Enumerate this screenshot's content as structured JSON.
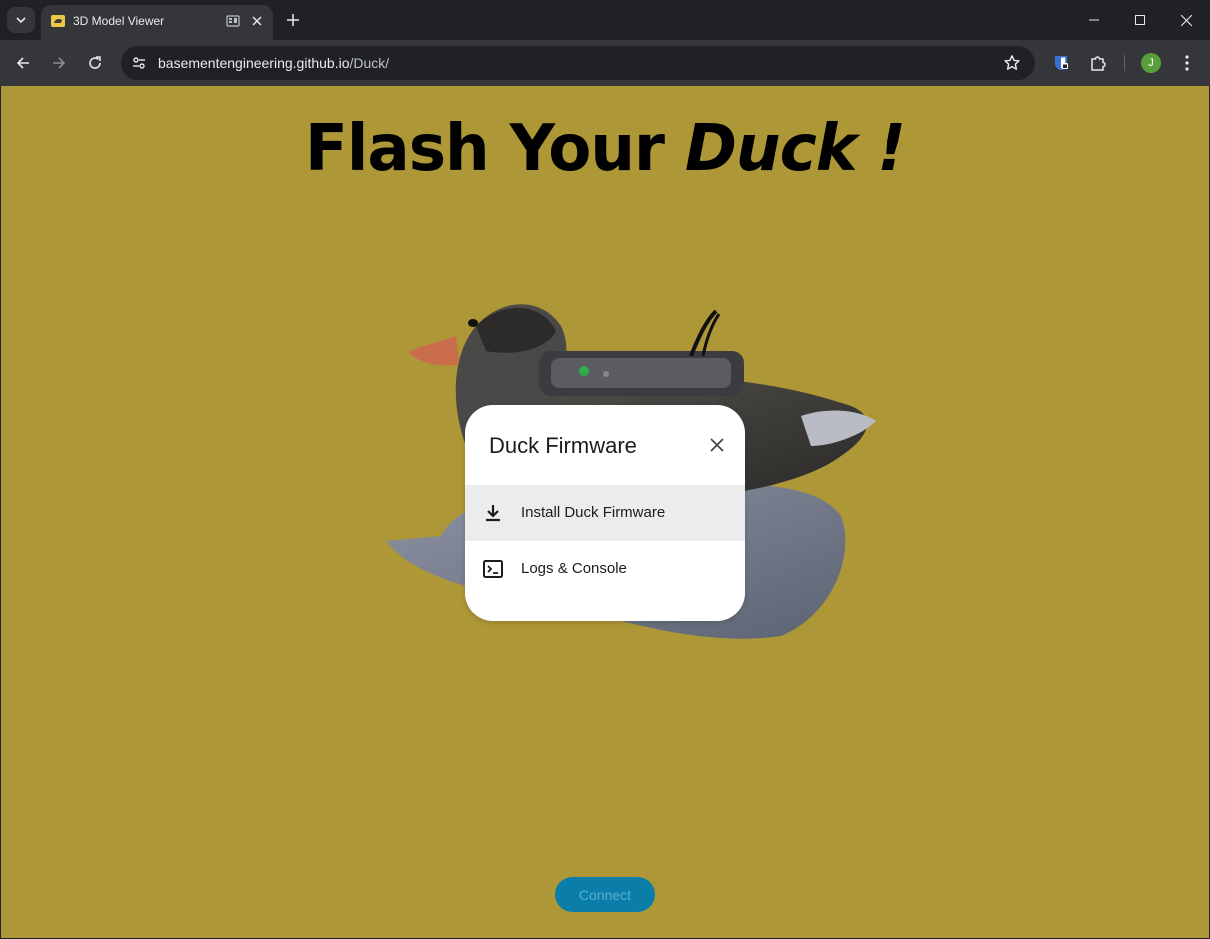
{
  "browser": {
    "tab_title": "3D Model Viewer",
    "url_host": "basementengineering.github.io",
    "url_path": "/Duck/",
    "profile_initial": "J"
  },
  "page": {
    "headline_plain": "Flash Your ",
    "headline_italic": "Duck !",
    "background_color": "#ad9737"
  },
  "dialog": {
    "title": "Duck Firmware",
    "items": [
      {
        "label": "Install Duck Firmware",
        "icon": "download-icon",
        "highlighted": true
      },
      {
        "label": "Logs & Console",
        "icon": "terminal-icon",
        "highlighted": false
      }
    ]
  },
  "connect_label": "Connect",
  "colors": {
    "connect_button": "#0a7ea8",
    "tab_bg": "#35363a",
    "frame_bg": "#202124"
  }
}
